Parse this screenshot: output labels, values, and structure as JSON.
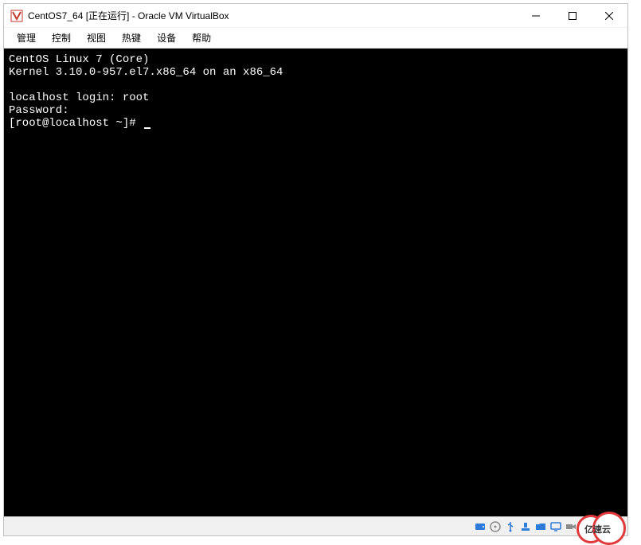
{
  "titlebar": {
    "title": "CentOS7_64 [正在运行] - Oracle VM VirtualBox"
  },
  "menubar": {
    "items": [
      "管理",
      "控制",
      "视图",
      "热键",
      "设备",
      "帮助"
    ]
  },
  "console": {
    "line1": "CentOS Linux 7 (Core)",
    "line2": "Kernel 3.10.0-957.el7.x86_64 on an x86_64",
    "line3": "",
    "line4": "localhost login: root",
    "line5": "Password:",
    "line6": "[root@localhost ~]# "
  },
  "statusbar": {
    "icons": [
      "hdd",
      "cd",
      "network",
      "usb",
      "shared-folder",
      "display",
      "recording",
      "audio",
      "cpu",
      "mouse"
    ]
  },
  "watermark": {
    "text": "亿速云"
  },
  "colors": {
    "icon_blue": "#2f7bd9",
    "icon_gray": "#8a8a8a",
    "close_red": "#e81123"
  }
}
